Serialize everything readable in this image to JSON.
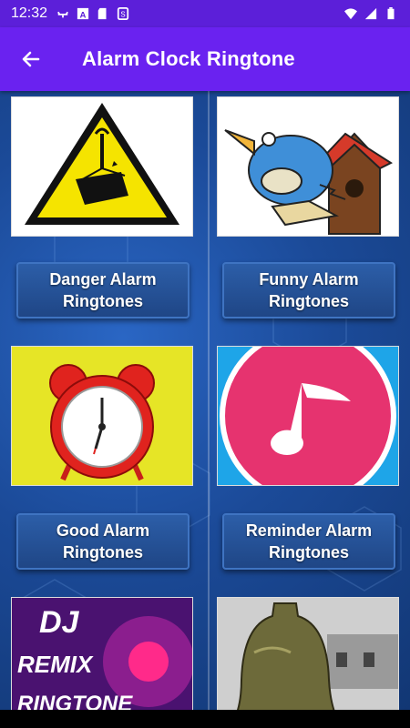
{
  "status": {
    "time": "12:32",
    "left_icons": [
      "usb-icon",
      "a-icon",
      "sd-card-icon",
      "sync-icon"
    ],
    "right_icons": [
      "wifi-icon",
      "signal-icon",
      "battery-icon"
    ]
  },
  "app_bar": {
    "title": "Alarm Clock Ringtone",
    "back_icon": "arrow-left-icon",
    "color": "#6a22f0",
    "status_color": "#5c1fd9"
  },
  "categories": [
    {
      "line1": "Danger Alarm",
      "line2": "Ringtones",
      "image": "warning-sign-image"
    },
    {
      "line1": "Funny Alarm",
      "line2": "Ringtones",
      "image": "cuckoo-bird-image"
    },
    {
      "line1": "Good Alarm",
      "line2": "Ringtones",
      "image": "red-alarm-clock-image"
    },
    {
      "line1": "Reminder Alarm",
      "line2": "Ringtones",
      "image": "music-note-image"
    },
    {
      "image": "dj-remix-image",
      "banner_top": "DJ",
      "banner_mid": "REMIX",
      "banner_bot": "RINGTONE"
    },
    {
      "image": "church-bell-image"
    }
  ]
}
